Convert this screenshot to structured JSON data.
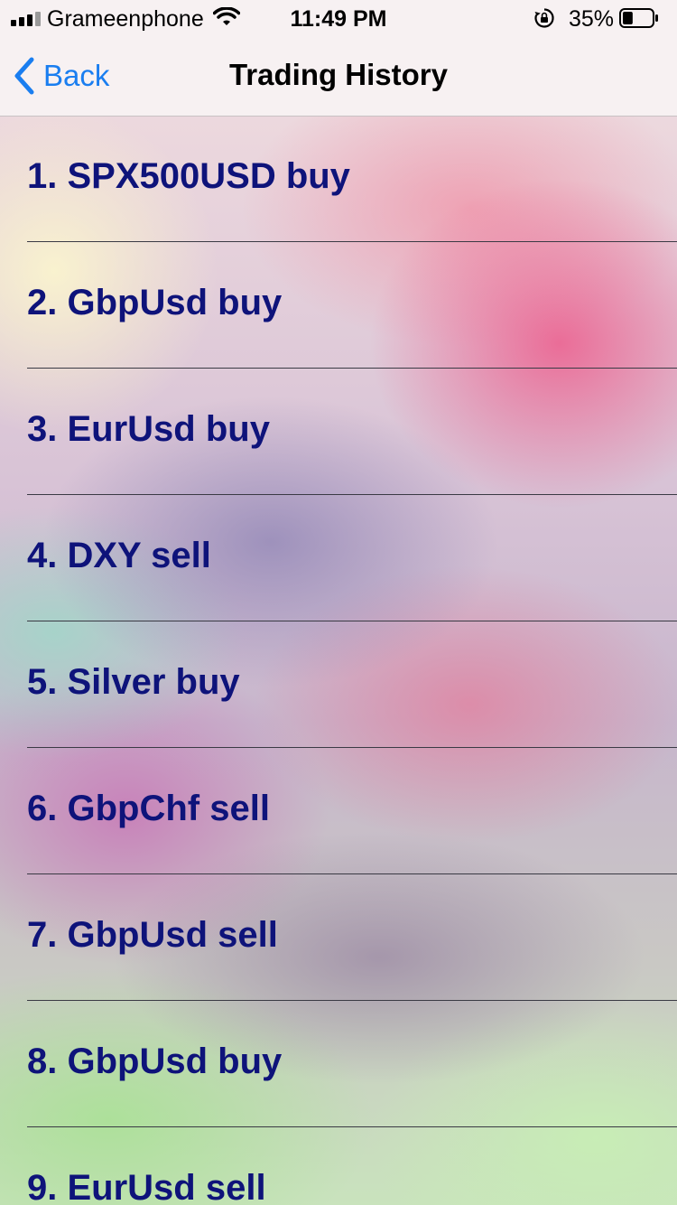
{
  "status_bar": {
    "carrier": "Grameenphone",
    "time": "11:49 PM",
    "battery_percent": "35%",
    "battery_level": 0.35
  },
  "nav": {
    "back_label": "Back",
    "title": "Trading History"
  },
  "trades": [
    {
      "text": "1.  SPX500USD buy"
    },
    {
      "text": "2.  GbpUsd buy"
    },
    {
      "text": "3.  EurUsd buy"
    },
    {
      "text": "4.  DXY sell"
    },
    {
      "text": "5.  Silver buy"
    },
    {
      "text": "6.  GbpChf sell"
    },
    {
      "text": "7.  GbpUsd sell"
    },
    {
      "text": "8.  GbpUsd buy"
    },
    {
      "text": "9.  EurUsd sell"
    }
  ],
  "colors": {
    "accent": "#1a7ef0",
    "item_text": "#0e137a"
  }
}
